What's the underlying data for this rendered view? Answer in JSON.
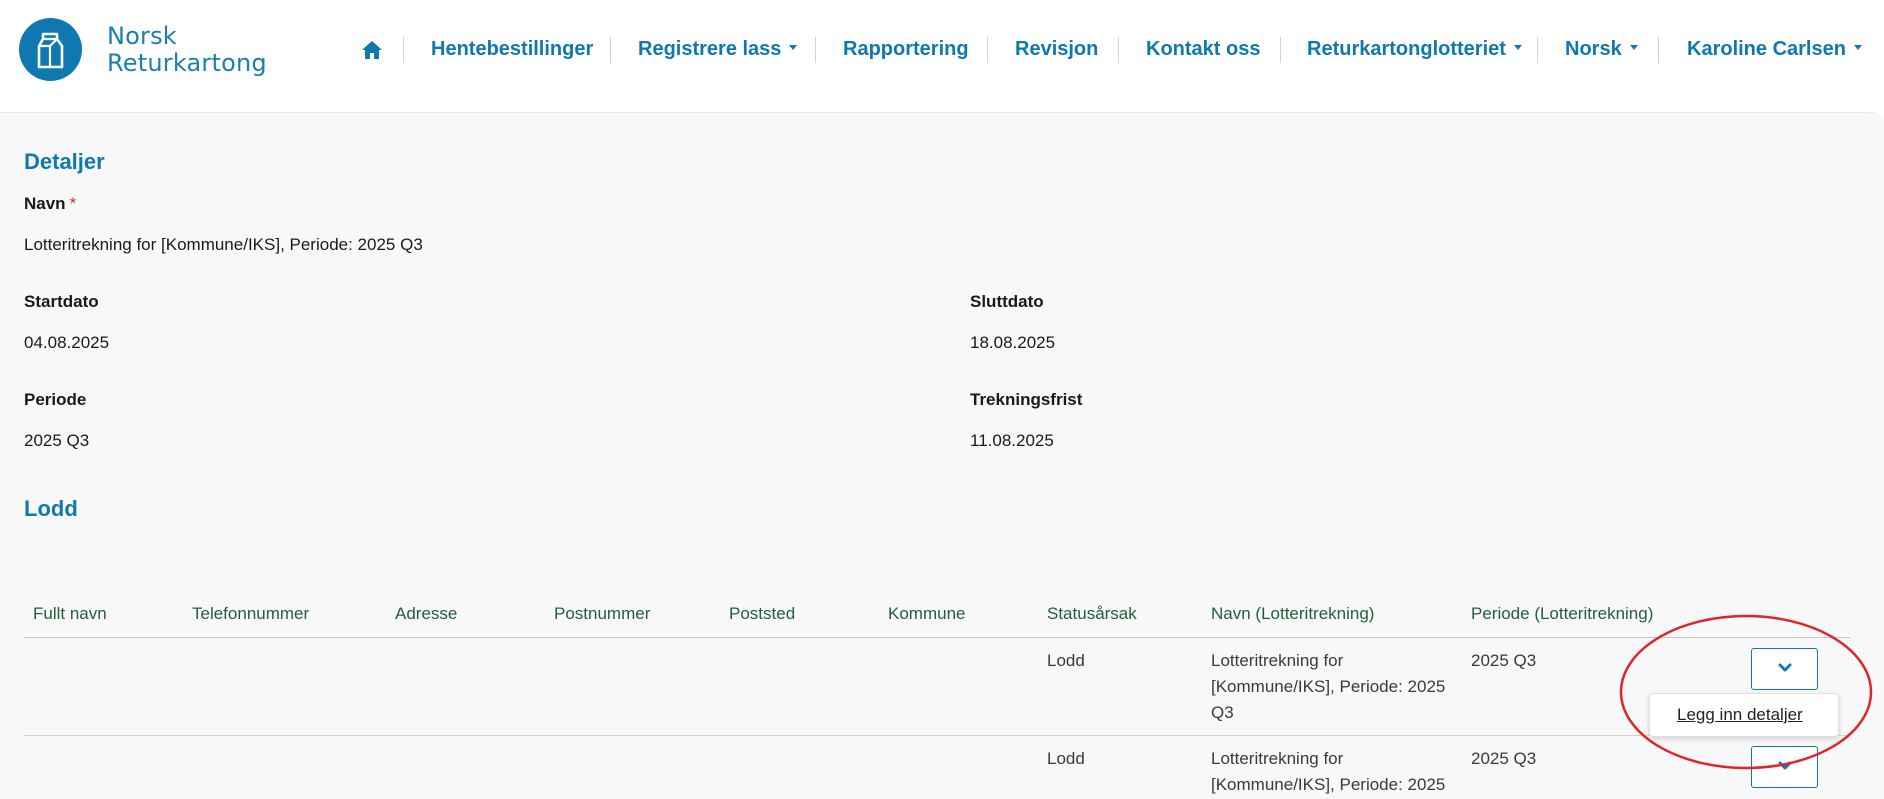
{
  "header": {
    "logo_line1": "Norsk",
    "logo_line2": "Returkartong",
    "nav": [
      {
        "label": "Hentebestillinger",
        "dropdown": false
      },
      {
        "label": "Registrere lass",
        "dropdown": true
      },
      {
        "label": "Rapportering",
        "dropdown": false
      },
      {
        "label": "Revisjon",
        "dropdown": false
      },
      {
        "label": "Kontakt oss",
        "dropdown": false
      },
      {
        "label": "Returkartonglotteriet",
        "dropdown": true
      },
      {
        "label": "Norsk",
        "dropdown": true
      },
      {
        "label": "Karoline Carlsen",
        "dropdown": true
      }
    ]
  },
  "details": {
    "title": "Detaljer",
    "navn_label": "Navn",
    "navn_required": "*",
    "navn_value": "Lotteritrekning for [Kommune/IKS], Periode: 2025 Q3",
    "startdato_label": "Startdato",
    "startdato_value": "04.08.2025",
    "sluttdato_label": "Sluttdato",
    "sluttdato_value": "18.08.2025",
    "periode_label": "Periode",
    "periode_value": "2025 Q3",
    "trekningsfrist_label": "Trekningsfrist",
    "trekningsfrist_value": "11.08.2025"
  },
  "lodd": {
    "title": "Lodd",
    "columns": [
      "Fullt navn",
      "Telefonnummer",
      "Adresse",
      "Postnummer",
      "Poststed",
      "Kommune",
      "Statusårsak",
      "Navn (Lotteritrekning)",
      "Periode (Lotteritrekning)"
    ],
    "rows": [
      {
        "fullt_navn": "",
        "telefonnummer": "",
        "adresse": "",
        "postnummer": "",
        "poststed": "",
        "kommune": "",
        "statusarsak": "Lodd",
        "navn_line1": "Lotteritrekning for",
        "navn_line2": "[Kommune/IKS], Periode: 2025",
        "navn_line3": "Q3",
        "periode": "2025 Q3"
      },
      {
        "fullt_navn": "",
        "telefonnummer": "",
        "adresse": "",
        "postnummer": "",
        "poststed": "",
        "kommune": "",
        "statusarsak": "Lodd",
        "navn_line1": "Lotteritrekning for",
        "navn_line2": "[Kommune/IKS], Periode: 2025",
        "navn_line3": "",
        "periode": "2025 Q3"
      }
    ],
    "popup_link": "Legg inn detaljer"
  },
  "colors": {
    "accent": "#0f78b0",
    "header_text": "#1f5f3f",
    "annotation": "#e0242b"
  },
  "icons": {
    "home": "home-icon",
    "expand": "chevron-down-icon",
    "logo": "milk-carton-icon"
  }
}
